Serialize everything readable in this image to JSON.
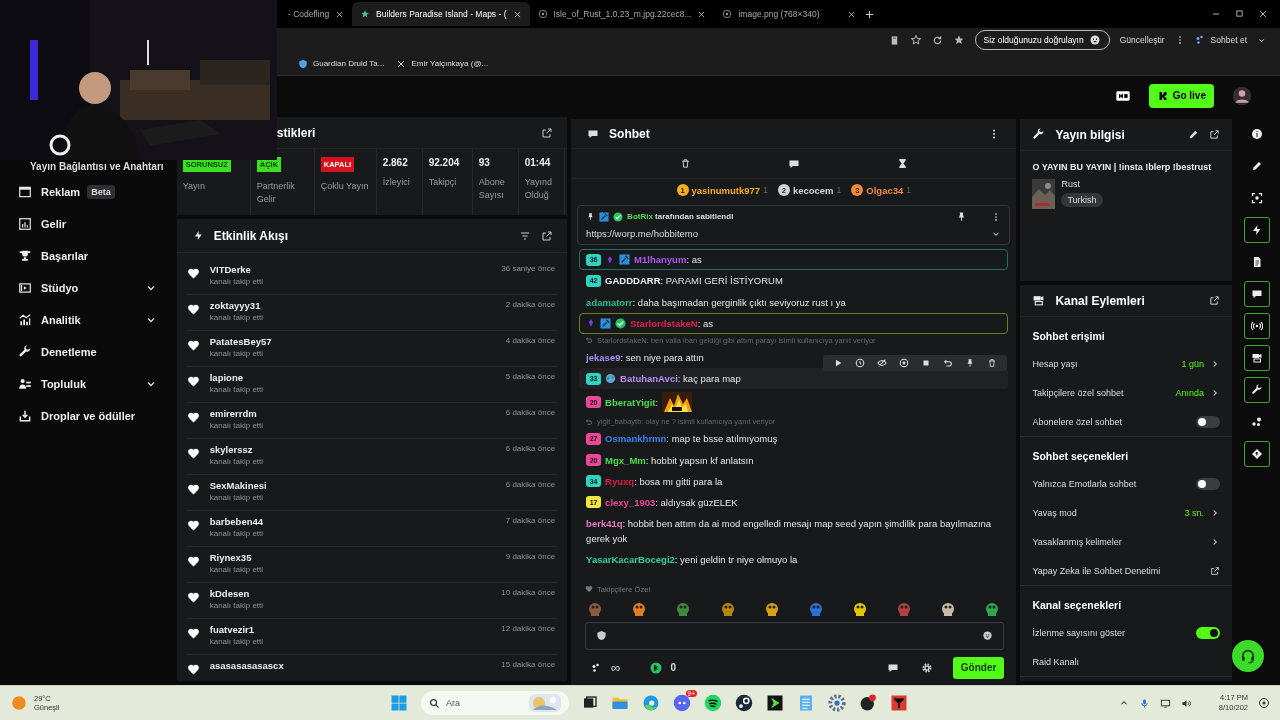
{
  "browser": {
    "tabs": [
      {
        "title": "- Codefling",
        "selected": false
      },
      {
        "title": "Builders Paradise Island - Maps - (",
        "selected": true
      },
      {
        "title": "Isle_of_Rust_1.0.23_m.jpg.22cec8...",
        "selected": false
      },
      {
        "title": "image.png (768×340)",
        "selected": false
      }
    ],
    "verify_button": "Siz olduğunuzu doğrulayın",
    "update_button": "Güncelleştir",
    "copilot_button": "Sohbet et",
    "bookmarks": [
      "Guardian Druid Ta...",
      "Emir Yalçınkaya (@..."
    ]
  },
  "header": {
    "go_live": "Go live"
  },
  "sidebar": {
    "partial_item": "Yayın Bağlantısı ve Anahtarı",
    "items": [
      {
        "label": "Reklam",
        "badge": "Beta",
        "expandable": false
      },
      {
        "label": "Gelir",
        "expandable": false
      },
      {
        "label": "Başarılar",
        "expandable": false
      },
      {
        "label": "Stüdyo",
        "expandable": true
      },
      {
        "label": "Analitik",
        "expandable": true
      },
      {
        "label": "Denetleme",
        "expandable": false
      },
      {
        "label": "Topluluk",
        "expandable": true
      },
      {
        "label": "Droplar ve ödüller",
        "expandable": false
      }
    ]
  },
  "stats": {
    "title": "stikleri",
    "cells": [
      {
        "kind": "badge",
        "value": "SORUNSUZ",
        "color": "#39e11f",
        "label": "Yayın"
      },
      {
        "kind": "badge",
        "value": "AÇIK",
        "color": "#39e11f",
        "label": "Partnerlik Gelir"
      },
      {
        "kind": "badge",
        "value": "KAPALI",
        "color": "#d8121d",
        "label": "Çoklu Yayın"
      },
      {
        "kind": "number",
        "value": "2.862",
        "label": "İzleyici"
      },
      {
        "kind": "number",
        "value": "92.204",
        "label": "Takipçi"
      },
      {
        "kind": "number",
        "value": "93",
        "label": "Abone Sayısı"
      },
      {
        "kind": "number",
        "value": "01:44",
        "label": "Yayınd Olduğ"
      }
    ]
  },
  "events": {
    "title": "Etkinlik Akışı",
    "items": [
      {
        "name": "VITDerke",
        "action": "kanalı takip etti",
        "time": "36 saniye önce"
      },
      {
        "name": "zoktayyy31",
        "action": "kanalı takip etti",
        "time": "2 dakika önce"
      },
      {
        "name": "PatatesBey57",
        "action": "kanalı takip etti",
        "time": "4 dakika önce"
      },
      {
        "name": "lapione",
        "action": "kanalı takip etti",
        "time": "5 dakika önce"
      },
      {
        "name": "emirerrdm",
        "action": "kanalı takip etti",
        "time": "6 dakika önce"
      },
      {
        "name": "skylerssz",
        "action": "kanalı takip etti",
        "time": "6 dakika önce"
      },
      {
        "name": "SexMakinesi",
        "action": "kanalı takip etti",
        "time": "6 dakika önce"
      },
      {
        "name": "barbeben44",
        "action": "kanalı takip etti",
        "time": "7 dakika önce"
      },
      {
        "name": "Riynex35",
        "action": "kanalı takip etti",
        "time": "9 dakika önce"
      },
      {
        "name": "kDdesen",
        "action": "kanalı takip etti",
        "time": "10 dakika önce"
      },
      {
        "name": "fuatvezir1",
        "action": "kanalı takip etti",
        "time": "12 dakika önce"
      },
      {
        "name": "asasasasasascx",
        "time": "15 dakika önce"
      }
    ]
  },
  "chat": {
    "title": "Sohbet",
    "leaders": [
      {
        "rank": "1",
        "name": "yasinumutk977",
        "count": "1",
        "color": "#f2b01e"
      },
      {
        "rank": "2",
        "name": "kecocem",
        "count": "1",
        "color": "#cfd3d6"
      },
      {
        "rank": "3",
        "name": "Olgac34",
        "count": "1",
        "color": "#f08a3c"
      }
    ],
    "pinned": {
      "by": "BotRix",
      "note": "tarafından sabitlendi",
      "text": "https://worp.me/hobbitemo"
    },
    "messages": [
      {
        "kind": "message",
        "badge": {
          "text": "36",
          "color": "#2dd4bf"
        },
        "gem": true,
        "mod": true,
        "user": "M1lhanyum",
        "color": "#a855f7",
        "text": ": as",
        "outline": {
          "color": "#1f6f66"
        },
        "hovered": false
      },
      {
        "kind": "message",
        "badge": {
          "text": "42",
          "color": "#2dd4bf"
        },
        "user": "GADDDARR",
        "color": "#f2f2f2",
        "text": ": PARAMI GERİ İSTİYORUM",
        "hovered": false
      },
      {
        "kind": "message",
        "user": "adamatorr",
        "color": "#2bbf8c",
        "text": ": daha başımadan gerginlik çıktı seviyoruz rust ı ya",
        "hovered": false
      },
      {
        "kind": "message",
        "gem": true,
        "mod": true,
        "verified": true,
        "user": "StarlordstakeN",
        "color": "#e0244c",
        "text": ": as",
        "outline": {
          "color": "#6d7f1c"
        },
        "hovered": false
      },
      {
        "kind": "reply",
        "text": "StarlordstakeN: ben valla iban geldiği gibi attım parayı isimli kullanıcıya yanıt veriyor"
      },
      {
        "kind": "message",
        "user": "jekase9",
        "color": "#a78bfa",
        "text": ": sen niye para attın",
        "hovered": false
      },
      {
        "kind": "message",
        "badge": {
          "text": "33",
          "color": "#2dd4bf"
        },
        "globe": true,
        "user": "BatuhanAvci",
        "color": "#b48cf0",
        "text": ": kaç para map",
        "hovered": true
      },
      {
        "kind": "message",
        "badge": {
          "text": "20",
          "color": "#ec4899"
        },
        "user": "BberatYigit",
        "color": "#4ade50",
        "text": ":",
        "emote": true,
        "hovered": false
      },
      {
        "kind": "reply",
        "text": "yigit_babaytb: olay ne ? isimli kullanıcıya yanıt veriyor"
      },
      {
        "kind": "message",
        "badge": {
          "text": "27",
          "color": "#ec4899"
        },
        "user": "Osmankhrmn",
        "color": "#3b82f6",
        "text": ": map te bsse atılmıyomuş",
        "hovered": false
      },
      {
        "kind": "message",
        "badge": {
          "text": "20",
          "color": "#ec4899"
        },
        "user": "Mgx_Mm",
        "color": "#4ade50",
        "text": ": hobbit yapsın kf anlatsın",
        "hovered": false
      },
      {
        "kind": "message",
        "badge": {
          "text": "34",
          "color": "#2dd4bf"
        },
        "user": "Ryuxq",
        "color": "#e11d48",
        "text": ": bosa mı gitti para la",
        "hovered": false
      },
      {
        "kind": "message",
        "badge": {
          "text": "17",
          "color": "#f5e642"
        },
        "user": "clexy_1903",
        "color": "#ec4899",
        "text": ": aldıysak güzELEK",
        "hovered": false
      },
      {
        "kind": "message",
        "user": "berk41q",
        "color": "#e879c9",
        "text": ": hobbit ben attım da ai mod engelledi mesajı map seed yapın şimdilik para bayılmazına gerek yok",
        "hovered": false
      },
      {
        "kind": "message",
        "user": "YasarKacarBocegi2",
        "color": "#34d399",
        "text": ": yeni geldin tr niye olmuyo la",
        "hovered": false
      }
    ],
    "emotes_label": "Takipçilere Özel",
    "infinity": "∞",
    "points": "0",
    "send": "Gönder"
  },
  "info": {
    "title": "Yayın bilgisi",
    "stream_title": "O YAYIN BU YAYIN | !insta !blerp !bestrust",
    "category": "Rust",
    "tag": "Turkish"
  },
  "actions": {
    "title": "Kanal Eylemleri",
    "sections": [
      {
        "heading": "Sohbet erişimi",
        "rows": [
          {
            "kind": "value",
            "label": "Hesap yaşı",
            "value": "1 gün"
          },
          {
            "kind": "value",
            "label": "Takipçilere özel sohbet",
            "value": "Anında"
          },
          {
            "kind": "toggle",
            "label": "Abonelere özel sohbet",
            "on": false
          }
        ]
      },
      {
        "heading": "Sohbet seçenekleri",
        "rows": [
          {
            "kind": "toggle",
            "label": "Yalnızca Emotlarla sohbet",
            "on": false
          },
          {
            "kind": "value",
            "label": "Yavaş mod",
            "value": "3 sn."
          },
          {
            "kind": "link",
            "label": "Yasaklanmış kelimeler"
          },
          {
            "kind": "external",
            "label": "Yapay Zeka ile Sohbet Denetimi"
          }
        ]
      },
      {
        "heading": "Kanal seçenekleri",
        "rows": [
          {
            "kind": "toggle",
            "label": "İzlenme sayısını göster",
            "on": true
          },
          {
            "kind": "plain",
            "label": "Raid Kanalı"
          }
        ]
      }
    ]
  },
  "rail": {
    "items": [
      {
        "selected": false
      },
      {
        "selected": false
      },
      {
        "selected": false
      },
      {
        "selected": true
      },
      {
        "selected": false
      },
      {
        "selected": true
      },
      {
        "selected": true
      },
      {
        "selected": true
      },
      {
        "selected": true
      },
      {
        "selected": false
      },
      {
        "selected": true
      }
    ]
  },
  "taskbar": {
    "temperature": "29°C",
    "weather": "Güneşli",
    "search_placeholder": "Ara",
    "chat_app_badge": "9+",
    "time": "4:17 PM",
    "date": "8/10/202"
  }
}
